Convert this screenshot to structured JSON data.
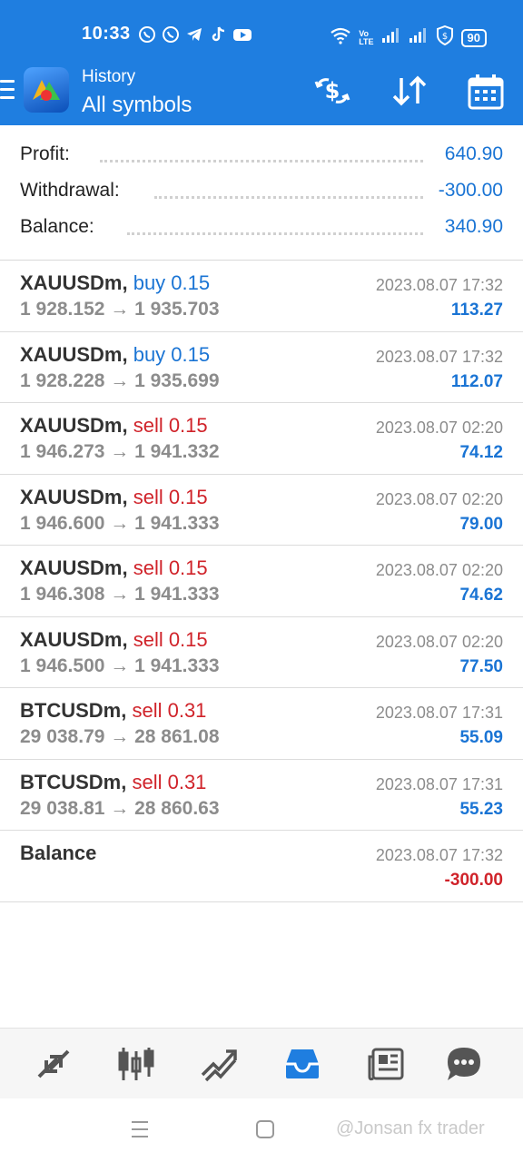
{
  "status": {
    "time": "10:33",
    "battery": "90"
  },
  "header": {
    "subtitle": "History",
    "title": "All symbols"
  },
  "summary": [
    {
      "label": "Profit:",
      "value": "640.90"
    },
    {
      "label": "Withdrawal:",
      "value": "-300.00"
    },
    {
      "label": "Balance:",
      "value": "340.90"
    }
  ],
  "deals": [
    {
      "symbol": "XAUUSDm,",
      "side": "buy 0.15",
      "type": "buy",
      "prices": "1 928.152 → 1 935.703",
      "datetime": "2023.08.07 17:32",
      "profit": "113.27"
    },
    {
      "symbol": "XAUUSDm,",
      "side": "buy 0.15",
      "type": "buy",
      "prices": "1 928.228 → 1 935.699",
      "datetime": "2023.08.07 17:32",
      "profit": "112.07"
    },
    {
      "symbol": "XAUUSDm,",
      "side": "sell 0.15",
      "type": "sell",
      "prices": "1 946.273 → 1 941.332",
      "datetime": "2023.08.07 02:20",
      "profit": "74.12"
    },
    {
      "symbol": "XAUUSDm,",
      "side": "sell 0.15",
      "type": "sell",
      "prices": "1 946.600 → 1 941.333",
      "datetime": "2023.08.07 02:20",
      "profit": "79.00"
    },
    {
      "symbol": "XAUUSDm,",
      "side": "sell 0.15",
      "type": "sell",
      "prices": "1 946.308 → 1 941.333",
      "datetime": "2023.08.07 02:20",
      "profit": "74.62"
    },
    {
      "symbol": "XAUUSDm,",
      "side": "sell 0.15",
      "type": "sell",
      "prices": "1 946.500 → 1 941.333",
      "datetime": "2023.08.07 02:20",
      "profit": "77.50"
    },
    {
      "symbol": "BTCUSDm,",
      "side": "sell 0.31",
      "type": "sell",
      "prices": "29 038.79 → 28 861.08",
      "datetime": "2023.08.07 17:31",
      "profit": "55.09"
    },
    {
      "symbol": "BTCUSDm,",
      "side": "sell 0.31",
      "type": "sell",
      "prices": "29 038.81 → 28 860.63",
      "datetime": "2023.08.07 17:31",
      "profit": "55.23"
    },
    {
      "symbol": "Balance",
      "side": "",
      "type": "balance",
      "prices": "",
      "datetime": "2023.08.07 17:32",
      "profit": "-300.00"
    }
  ],
  "colors": {
    "accent": "#1f7ee0",
    "positive": "#1a74d4",
    "negative": "#d0232a"
  },
  "watermark": "@Jonsan fx trader"
}
